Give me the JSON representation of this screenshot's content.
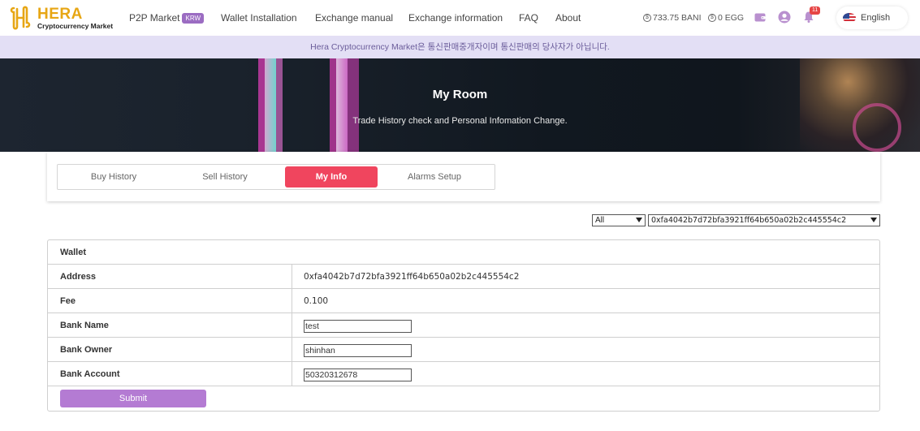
{
  "brand": {
    "name": "HERA",
    "subtitle": "Cryptocurrency Market"
  },
  "nav": {
    "p2p_label": "P2P Market",
    "krw_badge": "KRW",
    "wallet_installation": "Wallet Installation",
    "exchange_manual": "Exchange manual",
    "exchange_information": "Exchange information",
    "faq": "FAQ",
    "about": "About"
  },
  "balances": {
    "bani": "733.75 BANI",
    "egg": "0 EGG"
  },
  "notifications": {
    "count": "11"
  },
  "language": {
    "label": "English"
  },
  "notice": "Hera Cryptocurrency Market은 통신판매중개자이며 통신판매의 당사자가 아닙니다.",
  "hero": {
    "title": "My Room",
    "subtitle": "Trade History check and Personal Infomation Change."
  },
  "tabs": [
    "Buy History",
    "Sell History",
    "My Info",
    "Alarms Setup"
  ],
  "active_tab": "My Info",
  "filters": {
    "type_selected": "All",
    "address_selected": "0xfa4042b7d72bfa3921ff64b650a02b2c445554c2"
  },
  "wallet": {
    "header": "Wallet",
    "address_label": "Address",
    "address_value": "0xfa4042b7d72bfa3921ff64b650a02b2c445554c2",
    "fee_label": "Fee",
    "fee_value": "0.100",
    "bank_name_label": "Bank Name",
    "bank_name_value": "test",
    "bank_owner_label": "Bank Owner",
    "bank_owner_value": "shinhan",
    "bank_account_label": "Bank Account",
    "bank_account_value": "50320312678",
    "submit_label": "Submit"
  },
  "colors": {
    "accent_red": "#f0455e",
    "submit_purple": "#b47bd3",
    "notice_bg": "#e3dff5",
    "brand_gold": "#e7a614",
    "badge_purple": "#9b6cc2"
  }
}
